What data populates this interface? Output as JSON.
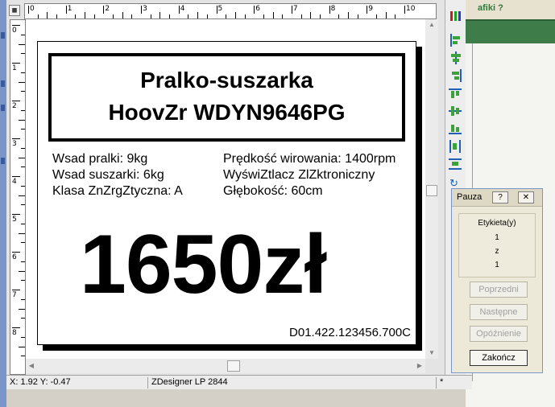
{
  "app": {
    "background_window_title": "afiki ?"
  },
  "ruler": {
    "horizontal_labels": [
      "0",
      "1",
      "2",
      "3",
      "4",
      "5",
      "6",
      "7",
      "8",
      "9",
      "10"
    ],
    "vertical_labels": [
      "0",
      "1",
      "2",
      "3",
      "4",
      "5",
      "6",
      "7",
      "8"
    ]
  },
  "label": {
    "title_line1": "Pralko-suszarka",
    "title_line2": "HoovZr WDYN9646PG",
    "specs_left": [
      "Wsad pralki: 9kg",
      "Wsad suszarki: 6kg",
      "Klasa ZnZrgZtyczna: A"
    ],
    "specs_right": [
      "Prędkość wirowania: 1400rpm",
      "WyświZtlacz ZlZktroniczny",
      "Głębokość: 60cm"
    ],
    "price": "1650zł",
    "code": "D01.422.123456.700C"
  },
  "status": {
    "coords": "X:  1.92 Y:  -0.47",
    "printer": "ZDesigner LP 2844",
    "flag": "*"
  },
  "dialog": {
    "title": "Pauza",
    "help_label": "?",
    "close_label": "✕",
    "panel_heading": "Etykieta(y)",
    "current": "1",
    "of_word": "z",
    "total": "1",
    "buttons": {
      "prev": "Poprzedni",
      "next": "Następne",
      "delay": "Opóźnienie",
      "finish": "Zakończ"
    }
  },
  "colors": {
    "accent_blue": "#1f5fb4",
    "accent_green": "#3e7d4a"
  }
}
